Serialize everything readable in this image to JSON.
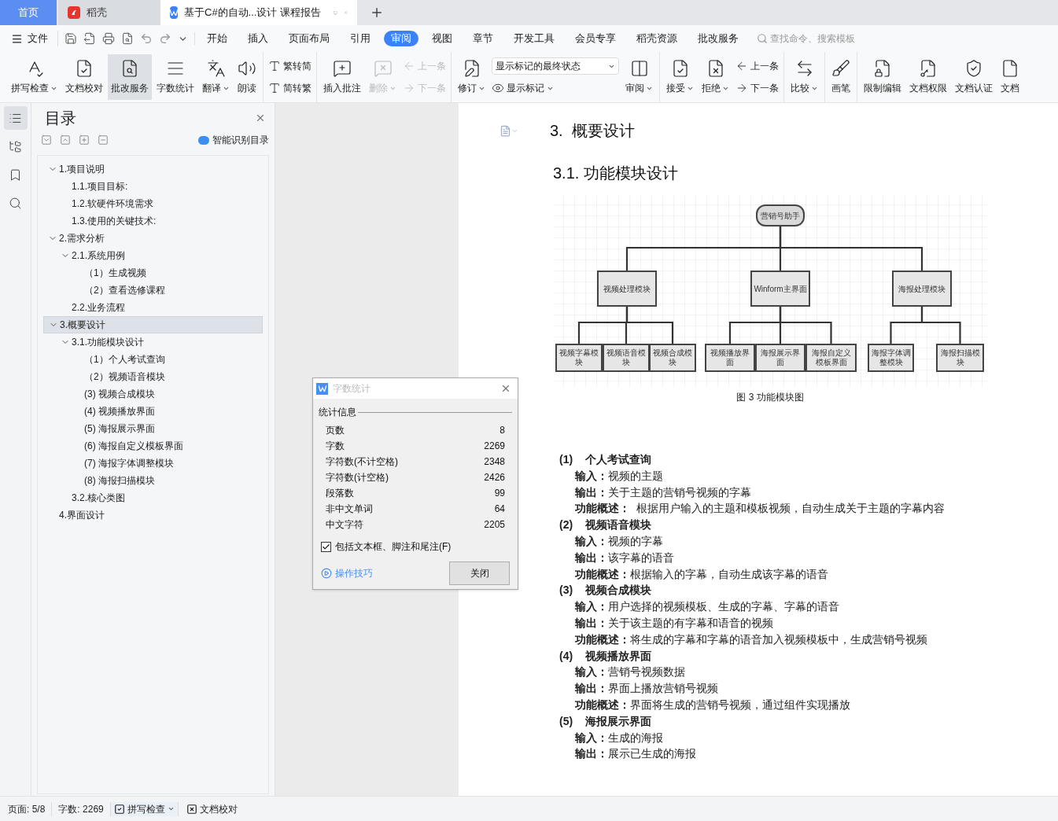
{
  "title_tabs": [
    {
      "kind": "home",
      "label": "首页",
      "selected": false
    },
    {
      "kind": "app",
      "label": "稻壳",
      "selected": false
    },
    {
      "kind": "document",
      "label": "基于C#的自动...设计 课程报告",
      "selected": true
    }
  ],
  "menu": {
    "file": "文件",
    "tabs": [
      {
        "label": "开始",
        "selected": false
      },
      {
        "label": "插入",
        "selected": false
      },
      {
        "label": "页面布局",
        "selected": false
      },
      {
        "label": "引用",
        "selected": false
      },
      {
        "label": "审阅",
        "selected": true
      },
      {
        "label": "视图",
        "selected": false
      },
      {
        "label": "章节",
        "selected": false
      },
      {
        "label": "开发工具",
        "selected": false
      },
      {
        "label": "会员专享",
        "selected": false
      },
      {
        "label": "稻壳资源",
        "selected": false
      },
      {
        "label": "批改服务",
        "selected": false
      }
    ],
    "search": {
      "placeholder": "查找命令、搜索模板"
    }
  },
  "ribbon": [
    {
      "items": [
        {
          "kind": "large",
          "label": "拼写检查",
          "caret": true,
          "selected": false
        },
        {
          "kind": "large",
          "label": "文档校对",
          "caret": false,
          "selected": false
        },
        {
          "kind": "large",
          "label": "批改服务",
          "caret": false,
          "selected": true
        },
        {
          "kind": "large",
          "label": "字数统计",
          "caret": false,
          "selected": false
        },
        {
          "kind": "large",
          "label": "翻译",
          "caret": true,
          "selected": false
        },
        {
          "kind": "large",
          "label": "朗读",
          "caret": false,
          "selected": false
        }
      ]
    },
    {
      "items": [
        {
          "kind": "stack",
          "items": [
            {
              "label": "繁转简"
            },
            {
              "label": "简转繁"
            }
          ]
        }
      ]
    },
    {
      "items": [
        {
          "kind": "large",
          "label": "插入批注",
          "caret": false,
          "disabled": false
        },
        {
          "kind": "large",
          "label": "删除",
          "caret": true,
          "disabled": true
        },
        {
          "kind": "stack",
          "items": [
            {
              "label": "上一条",
              "disabled": true
            },
            {
              "label": "下一条",
              "disabled": true
            }
          ]
        }
      ]
    },
    {
      "items": [
        {
          "kind": "large",
          "label": "修订",
          "caret": true
        },
        {
          "kind": "stack",
          "items": [
            {
              "kind": "select",
              "value": "显示标记的最终状态"
            },
            {
              "label": "显示标记",
              "caret": true
            }
          ]
        },
        {
          "kind": "large",
          "label": "审阅",
          "caret": true
        }
      ]
    },
    {
      "items": [
        {
          "kind": "large",
          "label": "接受",
          "caret": true
        },
        {
          "kind": "large",
          "label": "拒绝",
          "caret": true
        },
        {
          "kind": "stack",
          "items": [
            {
              "label": "上一条"
            },
            {
              "label": "下一条"
            }
          ]
        }
      ]
    },
    {
      "items": [
        {
          "kind": "large",
          "label": "比较",
          "caret": true
        }
      ]
    },
    {
      "items": [
        {
          "kind": "large",
          "label": "画笔",
          "caret": false
        }
      ]
    },
    {
      "items": [
        {
          "kind": "large",
          "label": "限制编辑",
          "caret": false
        },
        {
          "kind": "large",
          "label": "文档权限",
          "caret": false
        },
        {
          "kind": "large",
          "label": "文档认证",
          "caret": false
        },
        {
          "kind": "large",
          "label": "文档",
          "caret": false
        }
      ]
    }
  ],
  "side_icons": [
    {
      "selected": true
    },
    {
      "selected": false
    },
    {
      "selected": false
    },
    {
      "selected": false
    }
  ],
  "toc": {
    "title": "目录",
    "smart_button": "智能识别目录",
    "items": [
      {
        "label": "1.项目说明",
        "expanded": true,
        "selected": false,
        "children": [
          {
            "label": "1.1.项目目标:",
            "selected": false
          },
          {
            "label": "1.2.软硬件环境需求",
            "selected": false
          },
          {
            "label": "1.3.使用的关键技术:",
            "selected": false
          }
        ]
      },
      {
        "label": "2.需求分析",
        "expanded": true,
        "selected": false,
        "children": [
          {
            "label": "2.1.系统用例",
            "expanded": true,
            "selected": false,
            "children": [
              {
                "label": "（1）生成视频",
                "selected": false
              },
              {
                "label": "（2）查看选修课程",
                "selected": false
              }
            ]
          },
          {
            "label": "2.2.业务流程",
            "selected": false
          }
        ]
      },
      {
        "label": "3.概要设计",
        "expanded": true,
        "selected": true,
        "children": [
          {
            "label": "3.1.功能模块设计",
            "expanded": true,
            "selected": false,
            "children": [
              {
                "label": "（1）个人考试查询",
                "selected": false
              },
              {
                "label": "（2）视频语音模块",
                "selected": false
              },
              {
                "label": "(3)    视频合成模块",
                "selected": false
              },
              {
                "label": "(4)    视频播放界面",
                "selected": false
              },
              {
                "label": "(5)    海报展示界面",
                "selected": false
              },
              {
                "label": "(6)    海报自定义模板界面",
                "selected": false
              },
              {
                "label": "(7)    海报字体调整模块",
                "selected": false
              },
              {
                "label": "(8)    海报扫描模块",
                "selected": false
              }
            ]
          },
          {
            "label": "3.2.核心类图",
            "selected": false
          }
        ]
      },
      {
        "label": "4.界面设计",
        "selected": false
      }
    ]
  },
  "document": {
    "heading": "3.  概要设计",
    "subheading": "3.1. 功能模块设计",
    "diagram": {
      "root": "营销号助手",
      "children": [
        {
          "label": "视频处理模块",
          "children": [
            "视频字幕模块",
            "视频语音模块",
            "视频合成模块"
          ]
        },
        {
          "label": "Winform主界面",
          "children": [
            "视频播放界面",
            "海报展示界面",
            "海报自定义模板界面"
          ]
        },
        {
          "label": "海报处理模块",
          "children": [
            "海报字体调整模块",
            "海报扫描模块"
          ]
        }
      ]
    },
    "caption": "图 3 功能模块图",
    "modules": [
      {
        "number": "(1)",
        "title": "个人考试查询",
        "lines": [
          "**输入：**视频的主题",
          "**输出：**关于主题的营销号视频的字幕",
          "**功能概述：**  根据用户输入的主题和模板视频，自动生成关于主题的字幕内容"
        ]
      },
      {
        "number": "(2)",
        "title": "视频语音模块",
        "lines": [
          "**输入：**视频的字幕",
          "**输出：**该字幕的语音",
          "**功能概述：**根据输入的字幕，自动生成该字幕的语音"
        ]
      },
      {
        "number": "(3)",
        "title": "视频合成模块",
        "lines": [
          "**输入：**用户选择的视频模板、生成的字幕、字幕的语音",
          "**输出：**关于该主题的有字幕和语音的视频",
          "**功能概述：**将生成的字幕和字幕的语音加入视频模板中，生成营销号视频"
        ]
      },
      {
        "number": "(4)",
        "title": "视频播放界面",
        "lines": [
          "**输入：**营销号视频数据",
          "**输出：**界面上播放营销号视频",
          "**功能概述：**界面将生成的营销号视频，通过组件实现播放"
        ]
      },
      {
        "number": "(5)",
        "title": "海报展示界面",
        "lines": [
          "**输入：**生成的海报",
          "**输出：**展示已生成的海报"
        ]
      }
    ]
  },
  "dialog": {
    "title": "字数统计",
    "group": "统计信息",
    "rows": [
      {
        "label": "页数",
        "value": "8"
      },
      {
        "label": "字数",
        "value": "2269"
      },
      {
        "label": "字符数(不计空格)",
        "value": "2348"
      },
      {
        "label": "字符数(计空格)",
        "value": "2426"
      },
      {
        "label": "段落数",
        "value": "99"
      },
      {
        "label": "非中文单词",
        "value": "64"
      },
      {
        "label": "中文字符",
        "value": "2205"
      }
    ],
    "checkbox": {
      "label": "包括文本框、脚注和尾注(F)",
      "checked": true
    },
    "tips": "操作技巧",
    "close": "关闭"
  },
  "status_bar": {
    "page": "页面: 5/8",
    "words": "字数: 2269",
    "spell": "拼写检查",
    "proof": "文档校对"
  }
}
